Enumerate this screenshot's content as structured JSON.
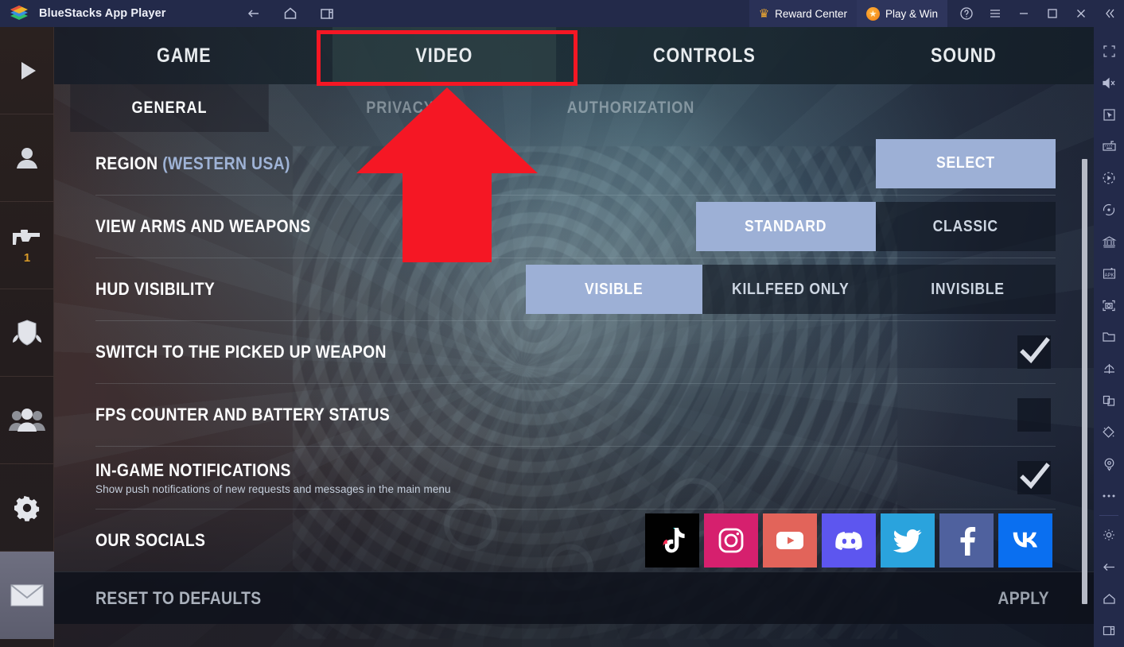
{
  "titlebar": {
    "app_title": "BlueStacks App Player",
    "nav": [
      {
        "name": "back-icon",
        "label": "←"
      },
      {
        "name": "home-icon",
        "label": "⌂"
      },
      {
        "name": "multi-instance-icon",
        "label": "❐"
      }
    ],
    "reward_center": "Reward Center",
    "play_and_win": "Play & Win",
    "help_label": "?",
    "menu_label": "≡",
    "minimize_label": "—",
    "maximize_label": "▢",
    "close_label": "✕",
    "collapse_label": "«"
  },
  "left_sidebar": {
    "items": [
      {
        "name": "play-icon",
        "badge": ""
      },
      {
        "name": "profile-icon",
        "badge": ""
      },
      {
        "name": "weapon-icon",
        "badge": "1"
      },
      {
        "name": "clan-shield-icon",
        "badge": ""
      },
      {
        "name": "friends-icon",
        "badge": ""
      },
      {
        "name": "settings-gear-icon",
        "badge": ""
      },
      {
        "name": "mail-icon",
        "badge": ""
      }
    ]
  },
  "right_sidebar": {
    "items": [
      "fullscreen-icon",
      "mute-icon",
      "cursor-icon",
      "keyboard-controls-icon",
      "macro-record-icon",
      "rotate-icon",
      "game-guide-icon",
      "install-apk-icon",
      "screenshot-icon",
      "media-folder-icon",
      "eco-mode-icon",
      "multi-window-icon",
      "shake-icon",
      "location-icon",
      "more-icon",
      "settings-icon",
      "back-icon",
      "home-icon",
      "recents-icon"
    ]
  },
  "tabs": {
    "main": [
      {
        "label": "GAME",
        "active": false
      },
      {
        "label": "VIDEO",
        "active": true
      },
      {
        "label": "CONTROLS",
        "active": false
      },
      {
        "label": "SOUND",
        "active": false
      }
    ],
    "sub": [
      {
        "label": "GENERAL",
        "active": true
      },
      {
        "label": "PRIVACY",
        "active": false
      },
      {
        "label": "AUTHORIZATION",
        "active": false
      }
    ]
  },
  "settings": {
    "rows": [
      {
        "name": "region",
        "label": "REGION",
        "label_sub": "(WESTERN USA)",
        "type": "button",
        "options": [
          {
            "label": "SELECT",
            "selected": true
          }
        ]
      },
      {
        "name": "view-arms-and-weapons",
        "label": "VIEW ARMS AND WEAPONS",
        "type": "segmented",
        "options": [
          {
            "label": "STANDARD",
            "selected": true
          },
          {
            "label": "CLASSIC",
            "selected": false
          }
        ]
      },
      {
        "name": "hud-visibility",
        "label": "HUD VISIBILITY",
        "type": "segmented",
        "options": [
          {
            "label": "VISIBLE",
            "selected": true
          },
          {
            "label": "KILLFEED ONLY",
            "selected": false
          },
          {
            "label": "INVISIBLE",
            "selected": false
          }
        ]
      },
      {
        "name": "switch-to-the-picked-up-weapon",
        "label": "SWITCH TO THE PICKED UP WEAPON",
        "type": "checkbox",
        "checked": true
      },
      {
        "name": "fps-counter-and-battery-status",
        "label": "FPS COUNTER AND BATTERY STATUS",
        "type": "checkbox",
        "checked": false
      },
      {
        "name": "in-game-notifications",
        "label": "IN-GAME NOTIFICATIONS",
        "description": "Show push notifications of new requests and messages in the main menu",
        "type": "checkbox",
        "checked": true
      },
      {
        "name": "our-socials",
        "label": "OUR SOCIALS",
        "type": "socials",
        "socials": [
          {
            "name": "tiktok-icon",
            "color": "#010101"
          },
          {
            "name": "instagram-icon",
            "color": "#d6206e"
          },
          {
            "name": "youtube-icon",
            "color": "#e2645a"
          },
          {
            "name": "discord-icon",
            "color": "#5d56ef"
          },
          {
            "name": "twitter-icon",
            "color": "#2aa3dd"
          },
          {
            "name": "facebook-icon",
            "color": "#4f619e"
          },
          {
            "name": "vk-icon",
            "color": "#0a6ff0"
          }
        ]
      }
    ],
    "reset_label": "RESET TO DEFAULTS",
    "apply_label": "APPLY"
  },
  "annotation": {
    "highlight_color": "#f51724",
    "arrow_color": "#f51724",
    "target": "VIDEO"
  }
}
